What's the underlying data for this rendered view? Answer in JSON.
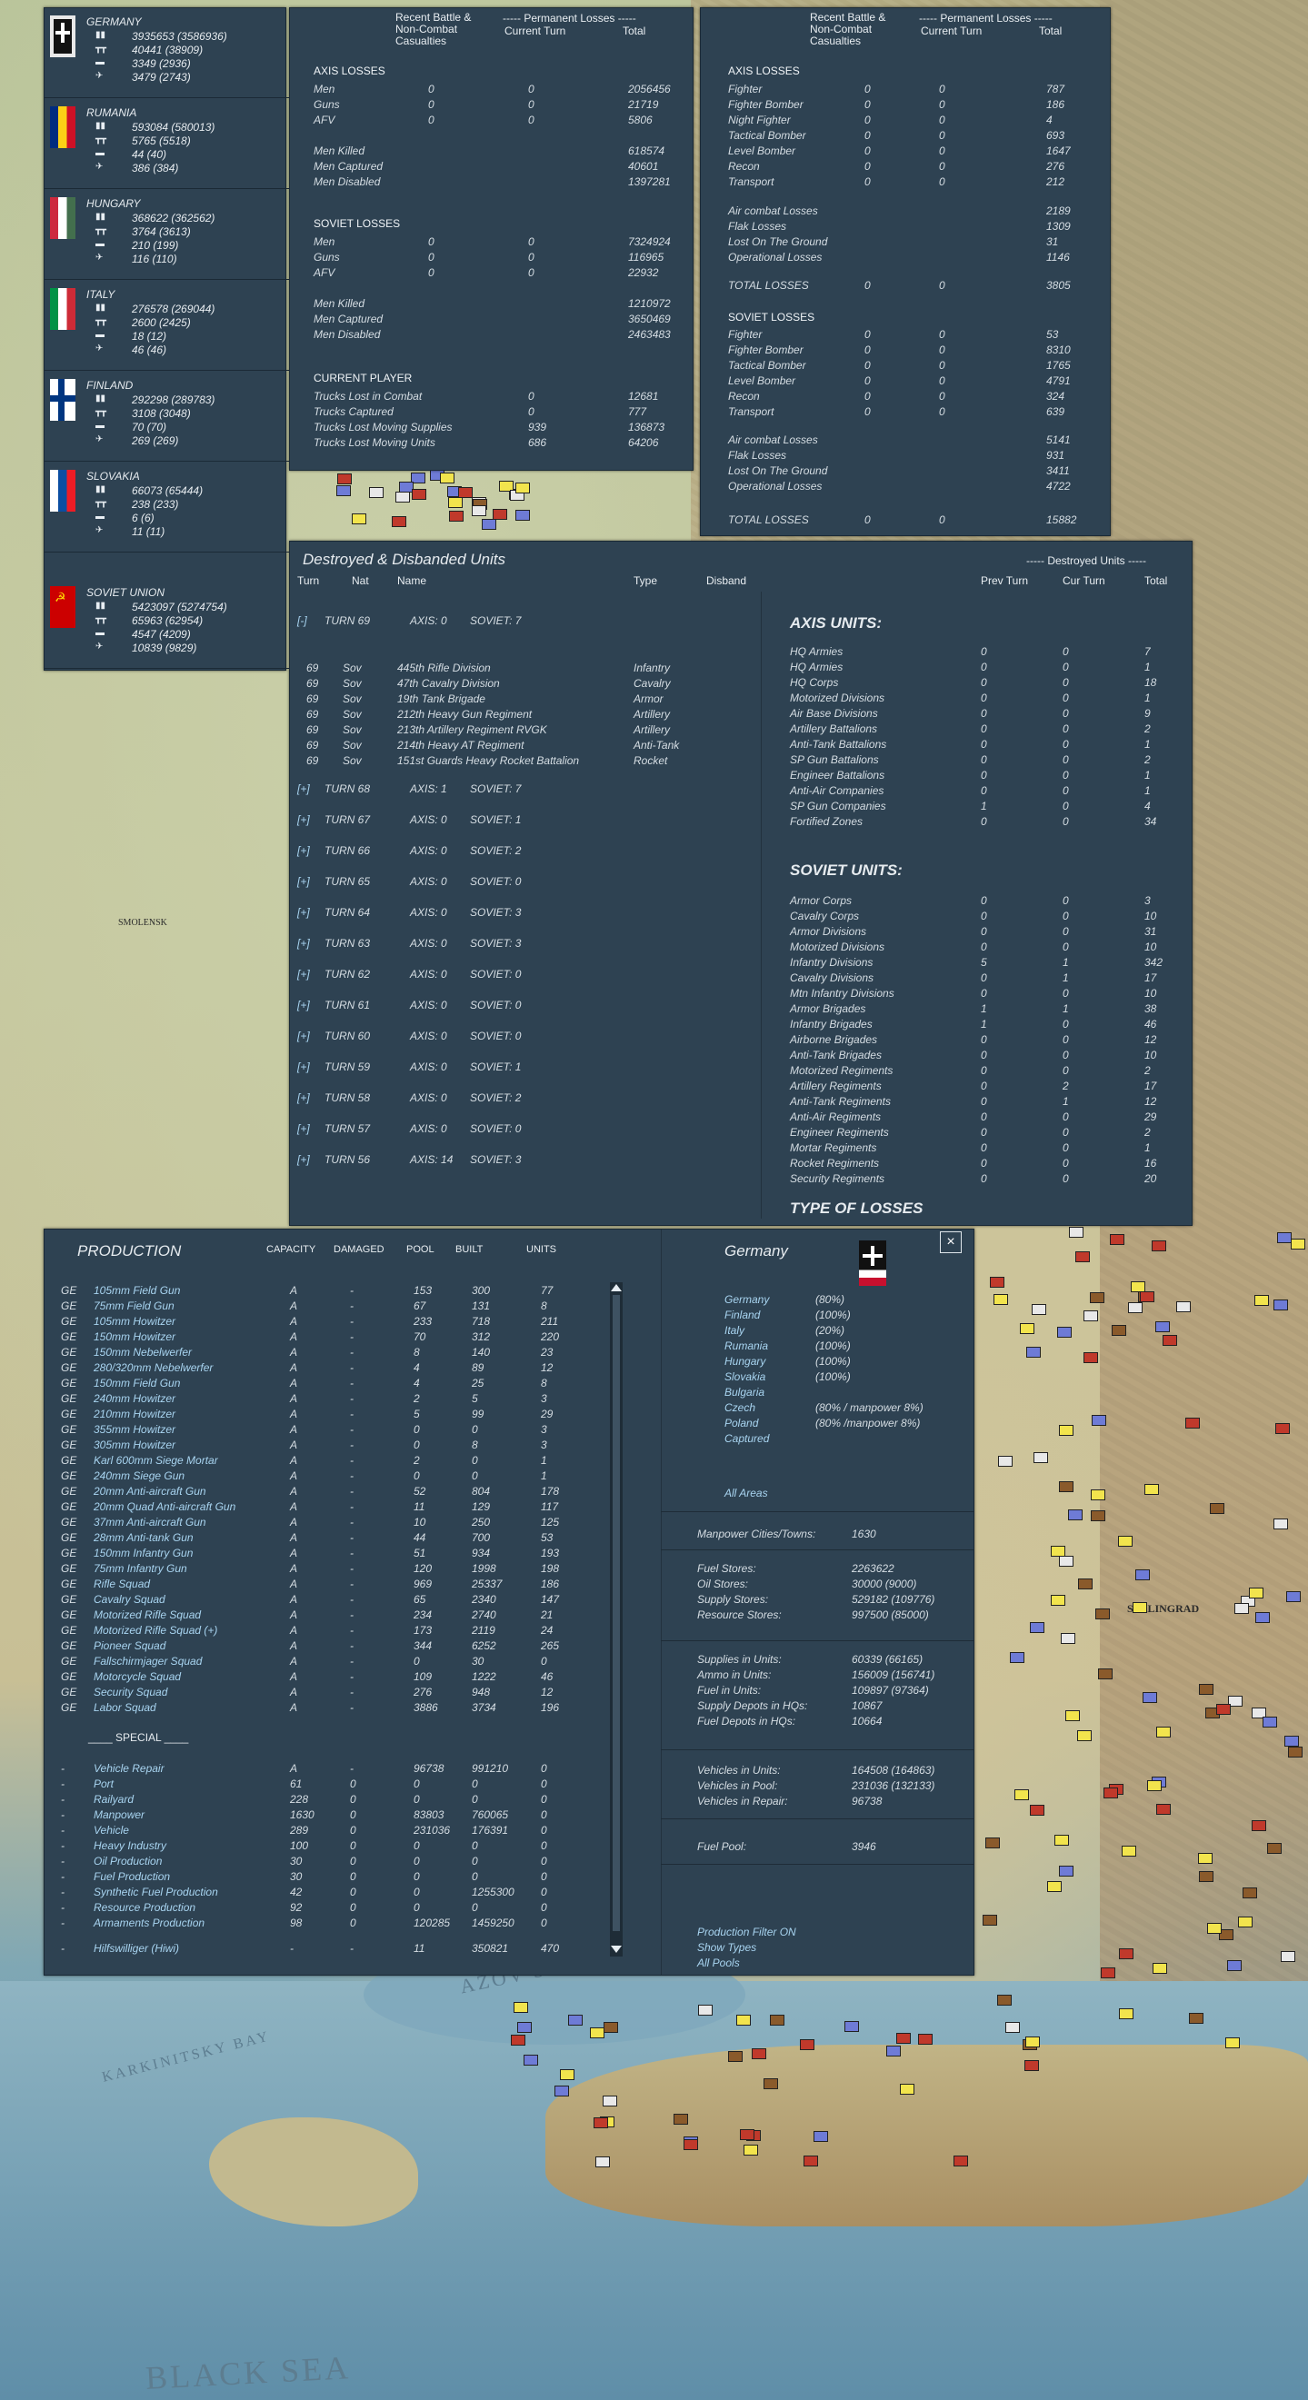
{
  "nations": [
    {
      "name": "GERMANY",
      "values": [
        "3935653 (3586936)",
        "40441 (38909)",
        "3349 (2936)",
        "3479 (2743)"
      ],
      "flag": "germany"
    },
    {
      "name": "RUMANIA",
      "values": [
        "593084 (580013)",
        "5765 (5518)",
        "44 (40)",
        "386 (384)"
      ],
      "flag": "rumania"
    },
    {
      "name": "HUNGARY",
      "values": [
        "368622 (362562)",
        "3764 (3613)",
        "210 (199)",
        "116 (110)"
      ],
      "flag": "hungary"
    },
    {
      "name": "ITALY",
      "values": [
        "276578 (269044)",
        "2600 (2425)",
        "18 (12)",
        "46 (46)"
      ],
      "flag": "italy"
    },
    {
      "name": "FINLAND",
      "values": [
        "292298 (289783)",
        "3108 (3048)",
        "70 (70)",
        "269 (269)"
      ],
      "flag": "finland"
    },
    {
      "name": "SLOVAKIA",
      "values": [
        "66073 (65444)",
        "238 (233)",
        "6 (6)",
        "11 (11)"
      ],
      "flag": "slovakia"
    },
    {
      "name": "SOVIET UNION",
      "values": [
        "5423097 (5274754)",
        "65963 (62954)",
        "4547 (4209)",
        "10839 (9829)"
      ],
      "flag": "soviet"
    }
  ],
  "ground_losses": {
    "col1": "Recent Battle & Non-Combat Casualties",
    "col2": "----- Permanent Losses -----",
    "col2a": "Current Turn",
    "col2b": "Total",
    "axis_title": "AXIS LOSSES",
    "axis": [
      [
        "Men",
        "0",
        "0",
        "2056456"
      ],
      [
        "Guns",
        "0",
        "0",
        "21719"
      ],
      [
        "AFV",
        "0",
        "0",
        "5806"
      ]
    ],
    "axis2": [
      [
        "Men Killed",
        "",
        "",
        "618574"
      ],
      [
        "Men Captured",
        "",
        "",
        "40601"
      ],
      [
        "Men Disabled",
        "",
        "",
        "1397281"
      ]
    ],
    "soviet_title": "SOVIET LOSSES",
    "soviet": [
      [
        "Men",
        "0",
        "0",
        "7324924"
      ],
      [
        "Guns",
        "0",
        "0",
        "116965"
      ],
      [
        "AFV",
        "0",
        "0",
        "22932"
      ]
    ],
    "soviet2": [
      [
        "Men Killed",
        "",
        "",
        "1210972"
      ],
      [
        "Men Captured",
        "",
        "",
        "3650469"
      ],
      [
        "Men Disabled",
        "",
        "",
        "2463483"
      ]
    ],
    "player_title": "CURRENT PLAYER",
    "player": [
      [
        "Trucks Lost in Combat",
        "",
        "0",
        "12681"
      ],
      [
        "Trucks Captured",
        "",
        "0",
        "777"
      ],
      [
        "Trucks Lost Moving Supplies",
        "",
        "939",
        "136873"
      ],
      [
        "Trucks Lost Moving Units",
        "",
        "686",
        "64206"
      ]
    ]
  },
  "air_losses": {
    "col1": "Recent Battle & Non-Combat Casualties",
    "col2": "----- Permanent Losses -----",
    "col2a": "Current Turn",
    "col2b": "Total",
    "axis_title": "AXIS LOSSES",
    "axis": [
      [
        "Fighter",
        "0",
        "0",
        "787"
      ],
      [
        "Fighter Bomber",
        "0",
        "0",
        "186"
      ],
      [
        "Night Fighter",
        "0",
        "0",
        "4"
      ],
      [
        "Tactical Bomber",
        "0",
        "0",
        "693"
      ],
      [
        "Level Bomber",
        "0",
        "0",
        "1647"
      ],
      [
        "Recon",
        "0",
        "0",
        "276"
      ],
      [
        "Transport",
        "0",
        "0",
        "212"
      ]
    ],
    "axis2": [
      [
        "Air combat Losses",
        "",
        "",
        "2189"
      ],
      [
        "Flak Losses",
        "",
        "",
        "1309"
      ],
      [
        "Lost On The Ground",
        "",
        "",
        "31"
      ],
      [
        "Operational Losses",
        "",
        "",
        "1146"
      ]
    ],
    "axis_total": [
      "TOTAL LOSSES",
      "0",
      "0",
      "3805"
    ],
    "soviet_title": "SOVIET LOSSES",
    "soviet": [
      [
        "Fighter",
        "0",
        "0",
        "53"
      ],
      [
        "Fighter Bomber",
        "0",
        "0",
        "8310"
      ],
      [
        "Tactical Bomber",
        "0",
        "0",
        "1765"
      ],
      [
        "Level Bomber",
        "0",
        "0",
        "4791"
      ],
      [
        "Recon",
        "0",
        "0",
        "324"
      ],
      [
        "Transport",
        "0",
        "0",
        "639"
      ]
    ],
    "soviet2": [
      [
        "Air combat Losses",
        "",
        "",
        "5141"
      ],
      [
        "Flak Losses",
        "",
        "",
        "931"
      ],
      [
        "Lost On The Ground",
        "",
        "",
        "3411"
      ],
      [
        "Operational Losses",
        "",
        "",
        "4722"
      ]
    ],
    "soviet_total": [
      "TOTAL LOSSES",
      "0",
      "0",
      "15882"
    ]
  },
  "destroyed": {
    "title": "Destroyed & Disbanded Units",
    "headers": [
      "Turn",
      "Nat",
      "Name",
      "Type",
      "Disband"
    ],
    "right_header": "----- Destroyed Units -----",
    "right_cols": [
      "Prev Turn",
      "Cur Turn",
      "Total"
    ],
    "expanded": {
      "toggle": "[-]",
      "label": "TURN 69",
      "axis": "AXIS: 0",
      "soviet": "SOVIET: 7"
    },
    "units": [
      [
        "69",
        "Sov",
        "445th Rifle Division",
        "Infantry"
      ],
      [
        "69",
        "Sov",
        "47th Cavalry Division",
        "Cavalry"
      ],
      [
        "69",
        "Sov",
        "19th Tank Brigade",
        "Armor"
      ],
      [
        "69",
        "Sov",
        "212th Heavy Gun Regiment",
        "Artillery"
      ],
      [
        "69",
        "Sov",
        "213th Artillery Regiment RVGK",
        "Artillery"
      ],
      [
        "69",
        "Sov",
        "214th Heavy AT Regiment",
        "Anti-Tank"
      ],
      [
        "69",
        "Sov",
        "151st Guards Heavy Rocket Battalion",
        "Rocket"
      ]
    ],
    "turns": [
      [
        "[+]",
        "TURN 68",
        "AXIS: 1",
        "SOVIET: 7"
      ],
      [
        "[+]",
        "TURN 67",
        "AXIS: 0",
        "SOVIET: 1"
      ],
      [
        "[+]",
        "TURN 66",
        "AXIS: 0",
        "SOVIET: 2"
      ],
      [
        "[+]",
        "TURN 65",
        "AXIS: 0",
        "SOVIET: 0"
      ],
      [
        "[+]",
        "TURN 64",
        "AXIS: 0",
        "SOVIET: 3"
      ],
      [
        "[+]",
        "TURN 63",
        "AXIS: 0",
        "SOVIET: 3"
      ],
      [
        "[+]",
        "TURN 62",
        "AXIS: 0",
        "SOVIET: 0"
      ],
      [
        "[+]",
        "TURN 61",
        "AXIS: 0",
        "SOVIET: 0"
      ],
      [
        "[+]",
        "TURN 60",
        "AXIS: 0",
        "SOVIET: 0"
      ],
      [
        "[+]",
        "TURN 59",
        "AXIS: 0",
        "SOVIET: 1"
      ],
      [
        "[+]",
        "TURN 58",
        "AXIS: 0",
        "SOVIET: 2"
      ],
      [
        "[+]",
        "TURN 57",
        "AXIS: 0",
        "SOVIET: 0"
      ],
      [
        "[+]",
        "TURN 56",
        "AXIS: 14",
        "SOVIET: 3"
      ]
    ],
    "axis_units_title": "AXIS UNITS:",
    "axis_units": [
      [
        "HQ Armies",
        "0",
        "0",
        "7"
      ],
      [
        "HQ Armies",
        "0",
        "0",
        "1"
      ],
      [
        "HQ Corps",
        "0",
        "0",
        "18"
      ],
      [
        "Motorized Divisions",
        "0",
        "0",
        "1"
      ],
      [
        "Air Base Divisions",
        "0",
        "0",
        "9"
      ],
      [
        "Artillery Battalions",
        "0",
        "0",
        "2"
      ],
      [
        "Anti-Tank Battalions",
        "0",
        "0",
        "1"
      ],
      [
        "SP Gun Battalions",
        "0",
        "0",
        "2"
      ],
      [
        "Engineer Battalions",
        "0",
        "0",
        "1"
      ],
      [
        "Anti-Air Companies",
        "0",
        "0",
        "1"
      ],
      [
        "SP Gun Companies",
        "1",
        "0",
        "4"
      ],
      [
        "Fortified Zones",
        "0",
        "0",
        "34"
      ]
    ],
    "soviet_units_title": "SOVIET UNITS:",
    "soviet_units": [
      [
        "Armor Corps",
        "0",
        "0",
        "3"
      ],
      [
        "Cavalry Corps",
        "0",
        "0",
        "10"
      ],
      [
        "Armor Divisions",
        "0",
        "0",
        "31"
      ],
      [
        "Motorized Divisions",
        "0",
        "0",
        "10"
      ],
      [
        "Infantry Divisions",
        "5",
        "1",
        "342"
      ],
      [
        "Cavalry Divisions",
        "0",
        "1",
        "17"
      ],
      [
        "Mtn Infantry Divisions",
        "0",
        "0",
        "10"
      ],
      [
        "Armor Brigades",
        "1",
        "1",
        "38"
      ],
      [
        "Infantry Brigades",
        "1",
        "0",
        "46"
      ],
      [
        "Airborne Brigades",
        "0",
        "0",
        "12"
      ],
      [
        "Anti-Tank Brigades",
        "0",
        "0",
        "10"
      ],
      [
        "Motorized Regiments",
        "0",
        "0",
        "2"
      ],
      [
        "Artillery Regiments",
        "0",
        "2",
        "17"
      ],
      [
        "Anti-Tank Regiments",
        "0",
        "1",
        "12"
      ],
      [
        "Anti-Air Regiments",
        "0",
        "0",
        "29"
      ],
      [
        "Engineer Regiments",
        "0",
        "0",
        "2"
      ],
      [
        "Mortar Regiments",
        "0",
        "0",
        "1"
      ],
      [
        "Rocket Regiments",
        "0",
        "0",
        "16"
      ],
      [
        "Security Regiments",
        "0",
        "0",
        "20"
      ]
    ],
    "type_title": "TYPE OF LOSSES"
  },
  "production": {
    "title": "PRODUCTION",
    "headers": [
      "CAPACITY",
      "DAMAGED",
      "POOL",
      "BUILT",
      "UNITS"
    ],
    "rows": [
      [
        "GE",
        "105mm Field Gun",
        "A",
        "-",
        "153",
        "300",
        "77"
      ],
      [
        "GE",
        "75mm Field Gun",
        "A",
        "-",
        "67",
        "131",
        "8"
      ],
      [
        "GE",
        "105mm Howitzer",
        "A",
        "-",
        "233",
        "718",
        "211"
      ],
      [
        "GE",
        "150mm Howitzer",
        "A",
        "-",
        "70",
        "312",
        "220"
      ],
      [
        "GE",
        "150mm Nebelwerfer",
        "A",
        "-",
        "8",
        "140",
        "23"
      ],
      [
        "GE",
        "280/320mm Nebelwerfer",
        "A",
        "-",
        "4",
        "89",
        "12"
      ],
      [
        "GE",
        "150mm Field Gun",
        "A",
        "-",
        "4",
        "25",
        "8"
      ],
      [
        "GE",
        "240mm Howitzer",
        "A",
        "-",
        "2",
        "5",
        "3"
      ],
      [
        "GE",
        "210mm Howitzer",
        "A",
        "-",
        "5",
        "99",
        "29"
      ],
      [
        "GE",
        "355mm Howitzer",
        "A",
        "-",
        "0",
        "0",
        "3"
      ],
      [
        "GE",
        "305mm Howitzer",
        "A",
        "-",
        "0",
        "8",
        "3"
      ],
      [
        "GE",
        "Karl 600mm Siege Mortar",
        "A",
        "-",
        "2",
        "0",
        "1"
      ],
      [
        "GE",
        "240mm Siege Gun",
        "A",
        "-",
        "0",
        "0",
        "1"
      ],
      [
        "GE",
        "20mm Anti-aircraft Gun",
        "A",
        "-",
        "52",
        "804",
        "178"
      ],
      [
        "GE",
        "20mm Quad Anti-aircraft Gun",
        "A",
        "-",
        "11",
        "129",
        "117"
      ],
      [
        "GE",
        "37mm Anti-aircraft Gun",
        "A",
        "-",
        "10",
        "250",
        "125"
      ],
      [
        "GE",
        "28mm Anti-tank Gun",
        "A",
        "-",
        "44",
        "700",
        "53"
      ],
      [
        "GE",
        "150mm Infantry Gun",
        "A",
        "-",
        "51",
        "934",
        "193"
      ],
      [
        "GE",
        "75mm Infantry Gun",
        "A",
        "-",
        "120",
        "1998",
        "198"
      ],
      [
        "GE",
        "Rifle Squad",
        "A",
        "-",
        "969",
        "25337",
        "186"
      ],
      [
        "GE",
        "Cavalry Squad",
        "A",
        "-",
        "65",
        "2340",
        "147"
      ],
      [
        "GE",
        "Motorized Rifle Squad",
        "A",
        "-",
        "234",
        "2740",
        "21"
      ],
      [
        "GE",
        "Motorized Rifle Squad (+)",
        "A",
        "-",
        "173",
        "2119",
        "24"
      ],
      [
        "GE",
        "Pioneer Squad",
        "A",
        "-",
        "344",
        "6252",
        "265"
      ],
      [
        "GE",
        "Fallschirmjager Squad",
        "A",
        "-",
        "0",
        "30",
        "0"
      ],
      [
        "GE",
        "Motorcycle Squad",
        "A",
        "-",
        "109",
        "1222",
        "46"
      ],
      [
        "GE",
        "Security Squad",
        "A",
        "-",
        "276",
        "948",
        "12"
      ],
      [
        "GE",
        "Labor Squad",
        "A",
        "-",
        "3886",
        "3734",
        "196"
      ]
    ],
    "special_title": "____ SPECIAL ____",
    "special": [
      [
        "-",
        "Vehicle Repair",
        "A",
        "-",
        "96738",
        "991210",
        "0"
      ],
      [
        "-",
        "Port",
        "61",
        "0",
        "0",
        "0",
        "0"
      ],
      [
        "-",
        "Railyard",
        "228",
        "0",
        "0",
        "0",
        "0"
      ],
      [
        "-",
        "Manpower",
        "1630",
        "0",
        "83803",
        "760065",
        "0"
      ],
      [
        "-",
        "Vehicle",
        "289",
        "0",
        "231036",
        "176391",
        "0"
      ],
      [
        "-",
        "Heavy Industry",
        "100",
        "0",
        "0",
        "0",
        "0"
      ],
      [
        "-",
        "Oil Production",
        "30",
        "0",
        "0",
        "0",
        "0"
      ],
      [
        "-",
        "Fuel Production",
        "30",
        "0",
        "0",
        "0",
        "0"
      ],
      [
        "-",
        "Synthetic Fuel Production",
        "42",
        "0",
        "0",
        "1255300",
        "0"
      ],
      [
        "-",
        "Resource Production",
        "92",
        "0",
        "0",
        "0",
        "0"
      ],
      [
        "-",
        "Armaments Production",
        "98",
        "0",
        "120285",
        "1459250",
        "0"
      ]
    ],
    "last": [
      "-",
      "Hilfswilliger (Hiwi)",
      "-",
      "-",
      "11",
      "350821",
      "470"
    ]
  },
  "country": {
    "title": "Germany",
    "list": [
      [
        "Germany",
        "(80%)"
      ],
      [
        "Finland",
        "(100%)"
      ],
      [
        "Italy",
        "(20%)"
      ],
      [
        "Rumania",
        "(100%)"
      ],
      [
        "Hungary",
        "(100%)"
      ],
      [
        "Slovakia",
        "(100%)"
      ],
      [
        "Bulgaria",
        ""
      ],
      [
        "Czech",
        "(80% / manpower 8%)"
      ],
      [
        "Poland",
        "(80% /manpower 8%)"
      ],
      [
        "Captured",
        ""
      ]
    ],
    "all_areas": "All Areas",
    "manpower": [
      "Manpower Cities/Towns:",
      "1630"
    ],
    "stores": [
      [
        "Fuel Stores:",
        "2263622"
      ],
      [
        "Oil Stores:",
        "30000 (9000)"
      ],
      [
        "Supply Stores:",
        "529182 (109776)"
      ],
      [
        "Resource Stores:",
        "997500 (85000)"
      ]
    ],
    "units": [
      [
        "Supplies in Units:",
        "60339 (66165)"
      ],
      [
        "Ammo in Units:",
        "156009 (156741)"
      ],
      [
        "Fuel in Units:",
        "109897 (97364)"
      ],
      [
        "Supply Depots in HQs:",
        "10867"
      ],
      [
        "Fuel Depots in HQs:",
        "10664"
      ]
    ],
    "vehicles": [
      [
        "Vehicles in Units:",
        "164508 (164863)"
      ],
      [
        "Vehicles in Pool:",
        "231036 (132133)"
      ],
      [
        "Vehicles in Repair:",
        "96738"
      ]
    ],
    "fuel_pool": [
      "Fuel Pool:",
      "3946"
    ],
    "links": [
      "Production Filter ON",
      "Show Types",
      "All Pools"
    ]
  },
  "map_labels": [
    "AZOV SEA",
    "BLACK SEA",
    "KARKINITSKY BAY",
    "STALINGRAD",
    "SMOLENSK"
  ],
  "close": "×"
}
